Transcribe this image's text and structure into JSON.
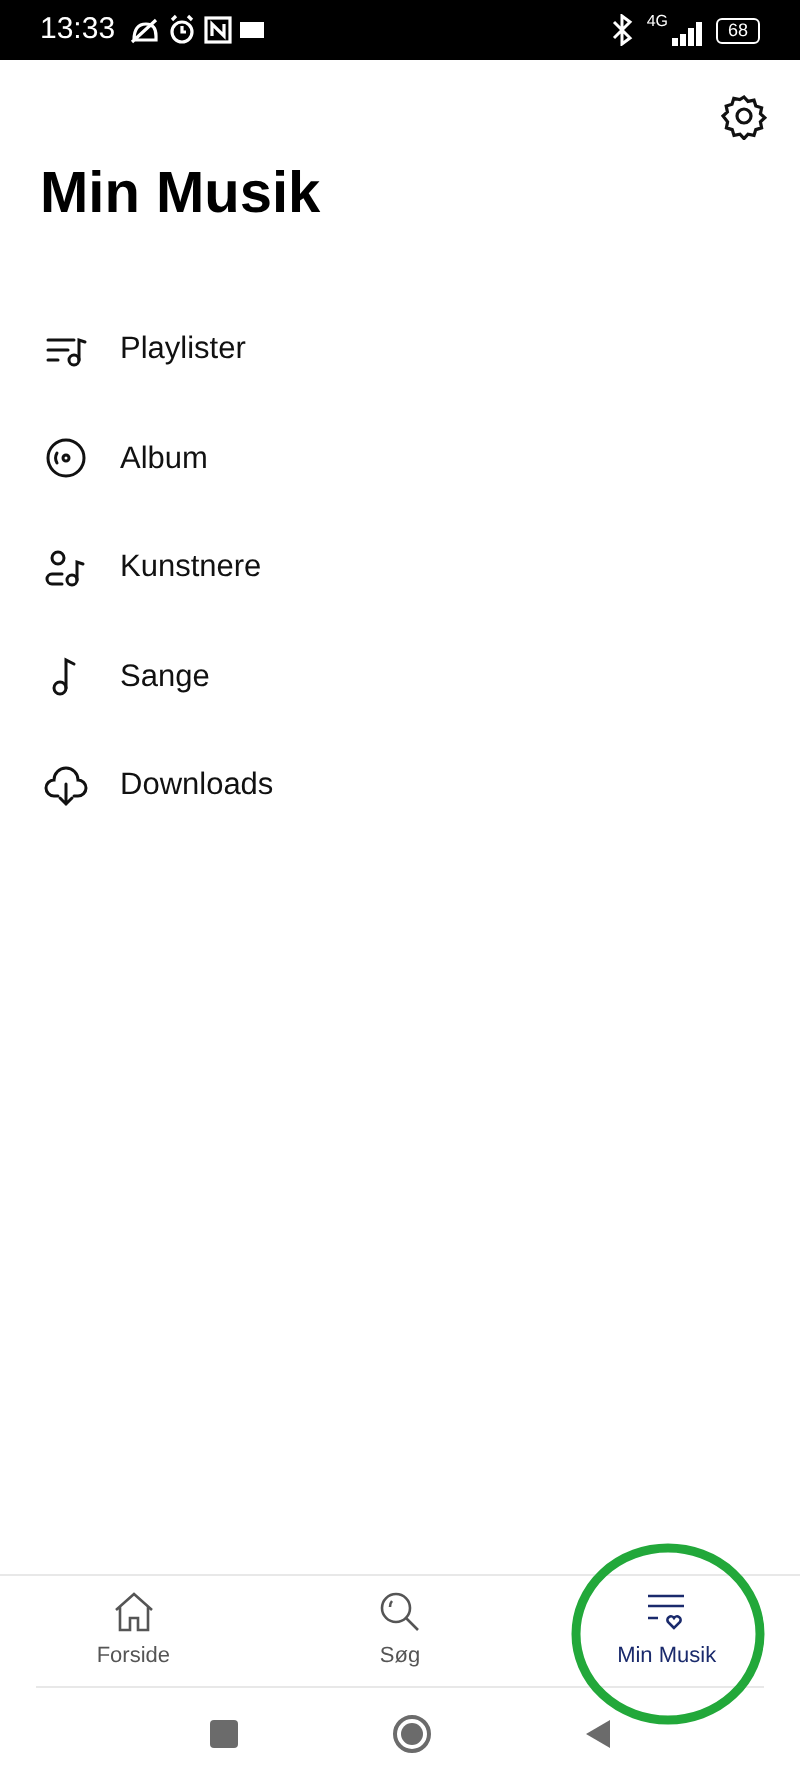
{
  "status_bar": {
    "time": "13:33",
    "network": "4G",
    "battery": "68"
  },
  "title": "Min Musik",
  "menu": [
    {
      "label": "Playlister"
    },
    {
      "label": "Album"
    },
    {
      "label": "Kunstnere"
    },
    {
      "label": "Sange"
    },
    {
      "label": "Downloads"
    }
  ],
  "bottom_nav": [
    {
      "label": "Forside",
      "selected": false
    },
    {
      "label": "Søg",
      "selected": false
    },
    {
      "label": "Min Musik",
      "selected": true
    }
  ]
}
